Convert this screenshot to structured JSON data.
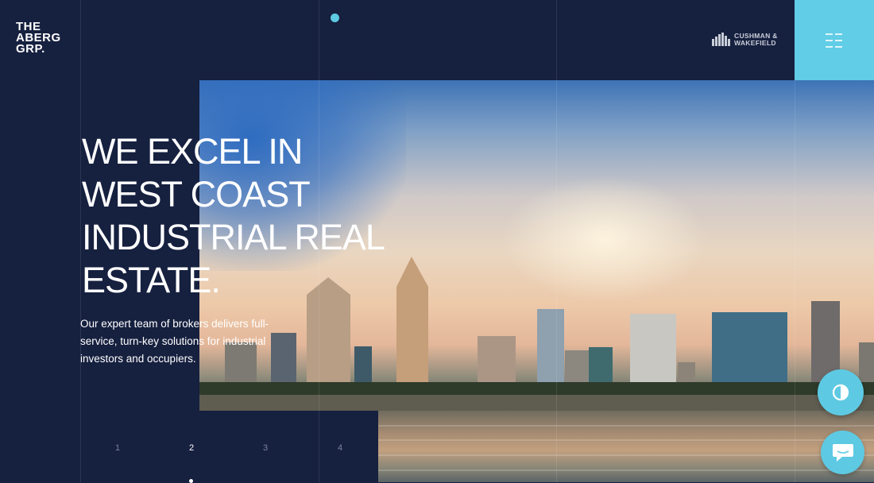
{
  "brand": {
    "logo_lines": [
      "THE",
      "ABERG",
      "GRP."
    ]
  },
  "partner": {
    "line1": "CUSHMAN &",
    "line2": "WAKEFIELD"
  },
  "hero": {
    "headline_lines": [
      "WE EXCEL IN",
      "WEST COAST",
      "INDUSTRIAL REAL",
      "ESTATE."
    ],
    "description": "Our expert team of brokers delivers full-service, turn-key solutions for industrial investors and occupiers."
  },
  "pagination": {
    "pages": [
      "1",
      "2",
      "3",
      "4"
    ],
    "active": "2"
  },
  "icons": {
    "menu": "hamburger-icon",
    "contrast": "contrast-icon",
    "chat": "chat-icon",
    "partner_logo": "building-logo-icon"
  },
  "colors": {
    "navy": "#16203f",
    "accent": "#61cde6",
    "white": "#ffffff"
  }
}
